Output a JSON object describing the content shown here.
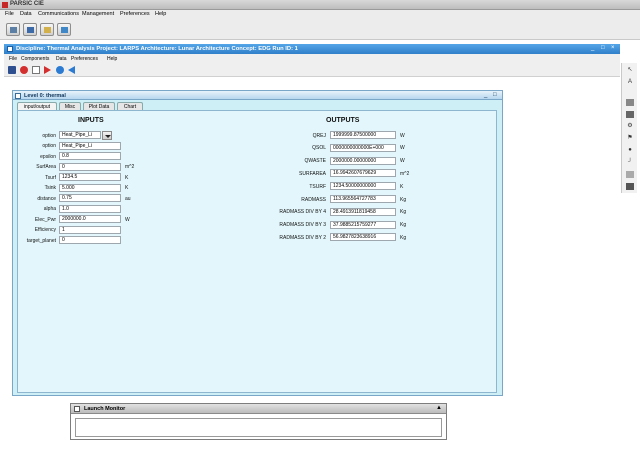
{
  "app": {
    "title": "PARSIC CIE",
    "menu": [
      "File",
      "Data",
      "Communications",
      "Management",
      "Preferences",
      "Help"
    ]
  },
  "discipline_window": {
    "title": "Discipline: Thermal Analysis  Project: LARPS  Architecture: Lunar Architecture  Concept: EDG  Run ID: 1",
    "menu": [
      "File",
      "Components",
      "Data",
      "Preferences",
      "Help"
    ],
    "controls": [
      "_",
      "□",
      "×"
    ]
  },
  "level_window": {
    "title": "Level 0: thermal",
    "controls": [
      "_",
      "□"
    ],
    "tabs": [
      "input/output",
      "Misc",
      "Plot Data",
      "Chart"
    ],
    "inputs_header": "INPUTS",
    "outputs_header": "OUTPUTS",
    "inputs": [
      {
        "label": "option",
        "value": "Heat_Pipe_Li",
        "unit": "",
        "dropdown": true
      },
      {
        "label": "option",
        "value": "Heat_Pipe_Li",
        "unit": ""
      },
      {
        "label": "epsilon",
        "value": "0.8",
        "unit": ""
      },
      {
        "label": "SurfArea",
        "value": "0",
        "unit": "m^2"
      },
      {
        "label": "Tsurf",
        "value": "1234.5",
        "unit": "K"
      },
      {
        "label": "Tsink",
        "value": "5.000",
        "unit": "K"
      },
      {
        "label": "distance",
        "value": "0.75",
        "unit": "au"
      },
      {
        "label": "alpha",
        "value": "1.0",
        "unit": ""
      },
      {
        "label": "Elec_Pwr",
        "value": "2000000.0",
        "unit": "W"
      },
      {
        "label": "Efficiency",
        "value": "1",
        "unit": ""
      },
      {
        "label": "target_planet",
        "value": "0",
        "unit": ""
      }
    ],
    "outputs": [
      {
        "label": "QREJ",
        "value": "1999999.87500000",
        "unit": "W"
      },
      {
        "label": "QSOL",
        "value": "0000000000000E+000",
        "unit": "W"
      },
      {
        "label": "QWASTE",
        "value": "2000000.00000000",
        "unit": "W"
      },
      {
        "label": "SURFAREA",
        "value": "16.9942607679629",
        "unit": "m^2"
      },
      {
        "label": "TSURF",
        "value": "1234.50000000000",
        "unit": "K"
      },
      {
        "label": "RADMASS",
        "value": "113.965564727783",
        "unit": "Kg"
      },
      {
        "label": "RADMASS DIV BY 4",
        "value": "28.4913911819458",
        "unit": "Kg"
      },
      {
        "label": "RADMASS DIV BY 3",
        "value": "37.9885215759277",
        "unit": "Kg"
      },
      {
        "label": "RADMASS DIV BY 2",
        "value": "56.9827823638916",
        "unit": "Kg"
      }
    ]
  },
  "launch_monitor": {
    "title": "Launch Monitor",
    "control": "▲"
  }
}
